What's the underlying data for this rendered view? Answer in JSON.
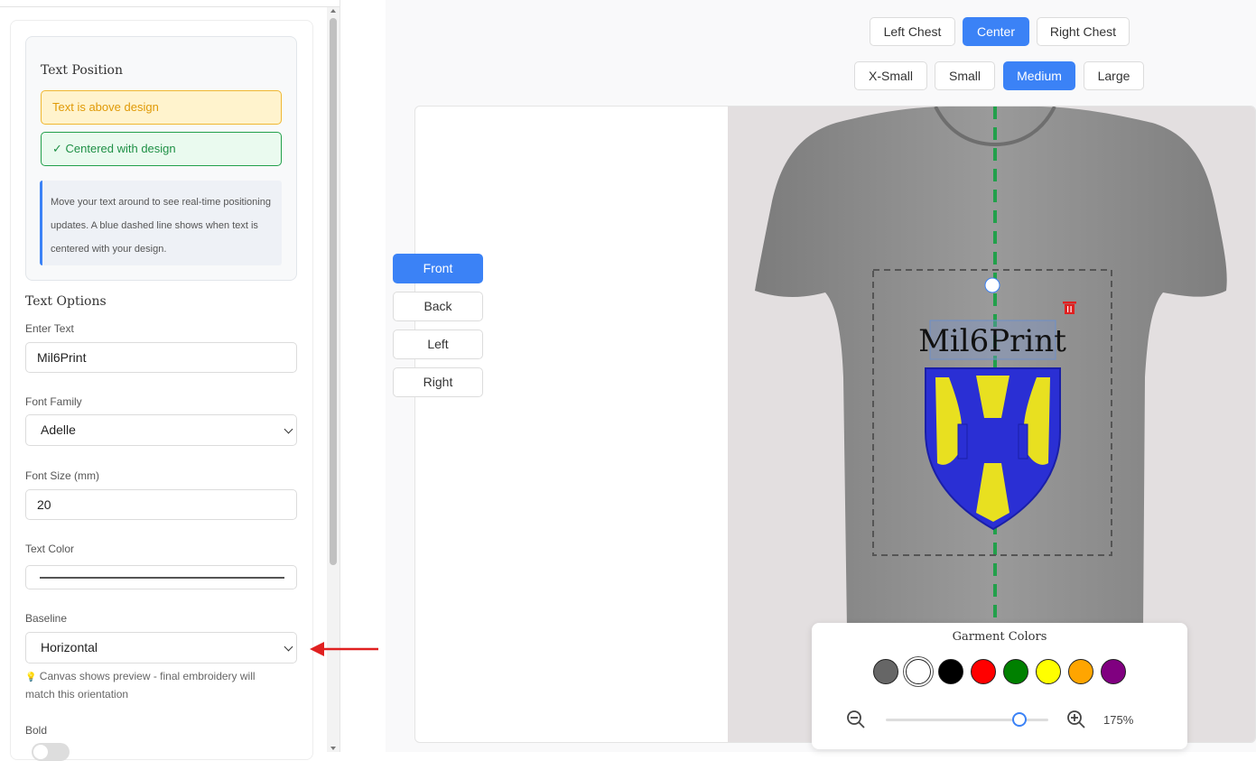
{
  "sidebar": {
    "text_position": {
      "title": "Text Position",
      "warning": "Text is above design",
      "centered": "✓ Centered with design",
      "info": "Move your text around to see real-time positioning updates. A blue dashed line shows when text is centered with your design."
    },
    "text_options": {
      "title": "Text Options",
      "enter_text_label": "Enter Text",
      "enter_text_value": "Mil6Print",
      "font_family_label": "Font Family",
      "font_family_value": "Adelle",
      "font_size_label": "Font Size (mm)",
      "font_size_value": "20",
      "text_color_label": "Text Color",
      "baseline_label": "Baseline",
      "baseline_value": "Horizontal",
      "hint": "Canvas shows preview - final embroidery will match this orientation",
      "bold_label": "Bold"
    }
  },
  "placement": {
    "buttons": [
      {
        "label": "Left Chest",
        "active": false
      },
      {
        "label": "Center",
        "active": true
      },
      {
        "label": "Right Chest",
        "active": false
      }
    ]
  },
  "size": {
    "buttons": [
      {
        "label": "X-Small",
        "active": false
      },
      {
        "label": "Small",
        "active": false
      },
      {
        "label": "Medium",
        "active": true
      },
      {
        "label": "Large",
        "active": false
      }
    ]
  },
  "views": [
    {
      "label": "Front",
      "active": true
    },
    {
      "label": "Back",
      "active": false
    },
    {
      "label": "Left",
      "active": false
    },
    {
      "label": "Right",
      "active": false
    }
  ],
  "canvas": {
    "text": "Mil6Print",
    "center_line_color": "#22a04b",
    "shirt_color": "#8e8e8e"
  },
  "garment_colors": {
    "title": "Garment Colors",
    "colors": [
      "#666666",
      "#ffffff",
      "#000000",
      "#ff0000",
      "#008000",
      "#ffff00",
      "#ffa500",
      "#800080"
    ],
    "selected": "#ffffff"
  },
  "zoom": {
    "label": "175%",
    "value": 175,
    "level": 0.82
  },
  "accent_color": "#3b82f6"
}
